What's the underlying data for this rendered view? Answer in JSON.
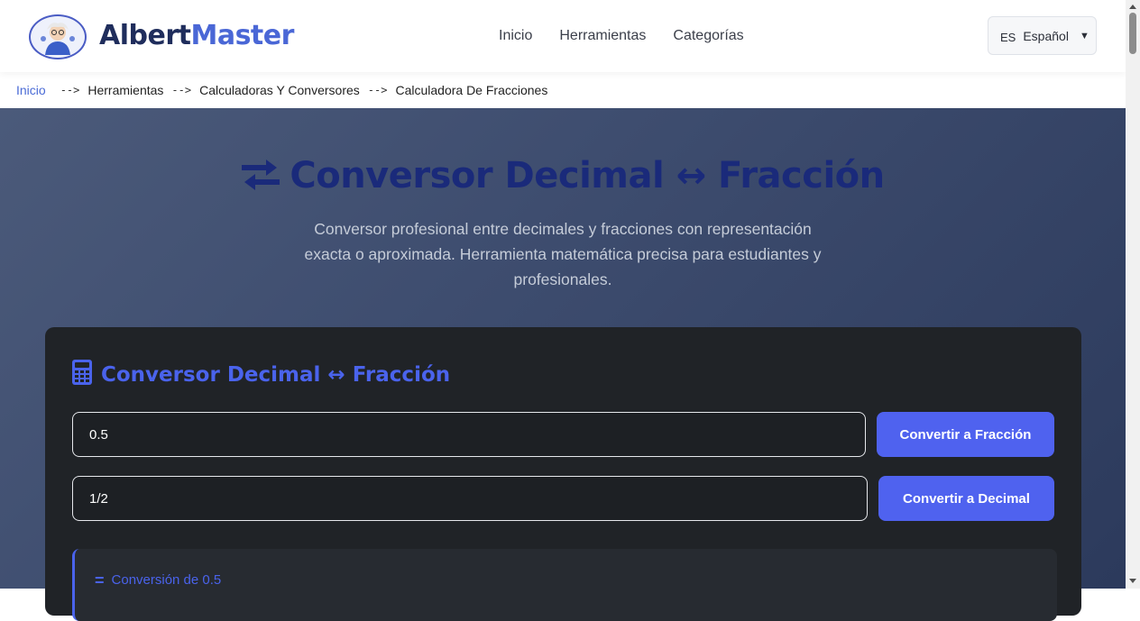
{
  "header": {
    "logo_part1": "Albert",
    "logo_part2": "Master",
    "nav": [
      "Inicio",
      "Herramientas",
      "Categorías"
    ],
    "language": {
      "code": "ES",
      "label": "Español",
      "caret": "▼"
    }
  },
  "breadcrumb": {
    "items": [
      "Inicio",
      "Herramientas",
      "Calculadoras Y Conversores",
      "Calculadora De Fracciones"
    ],
    "separator": "-->"
  },
  "hero": {
    "title": "Conversor Decimal ↔ Fracción",
    "description": "Conversor profesional entre decimales y fracciones con representación exacta o aproximada. Herramienta matemática precisa para estudiantes y profesionales."
  },
  "converter": {
    "title": "Conversor Decimal ↔ Fracción",
    "decimal_value": "0.5",
    "fraction_value": "1/2",
    "to_fraction_label": "Convertir a Fracción",
    "to_decimal_label": "Convertir a Decimal",
    "result_label": "Conversión de 0.5"
  },
  "colors": {
    "accent": "#4f62ef",
    "title_dark_blue": "#1a2a7a",
    "card_bg": "#202327"
  }
}
